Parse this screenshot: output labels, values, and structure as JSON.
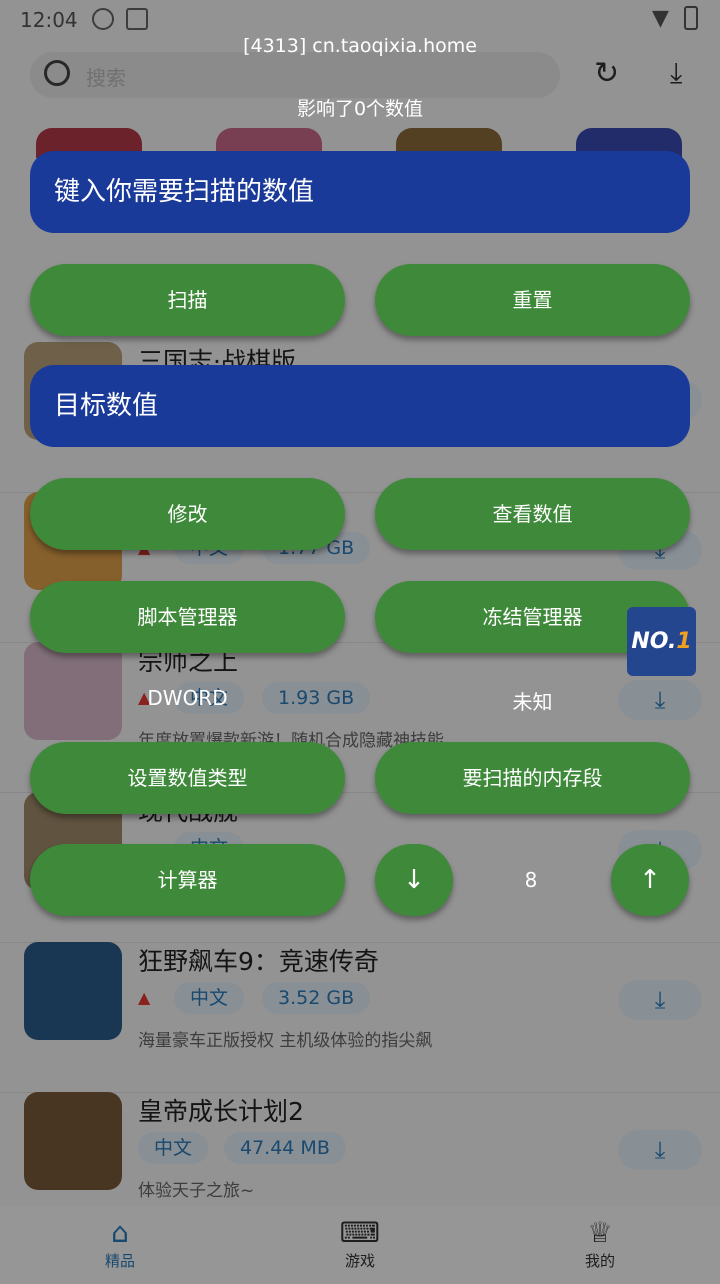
{
  "status_bar": {
    "time": "12:04"
  },
  "app": {
    "search_placeholder": "搜索",
    "games": [
      {
        "name": "三国志·战棋版",
        "tags": [],
        "desc": ""
      },
      {
        "name": "",
        "tags": [
          "中文",
          "1.77 GB"
        ],
        "desc": ""
      },
      {
        "name": "宗师之上",
        "tags": [
          "中文",
          "1.93 GB"
        ],
        "desc": "年度放置爆款新游！随机合成隐藏神技能"
      },
      {
        "name": "现代战舰",
        "tags": [
          "中文",
          ""
        ],
        "desc": ""
      },
      {
        "name": "狂野飙车9：竞速传奇",
        "tags": [
          "中文",
          "3.52 GB"
        ],
        "desc": "海量豪车正版授权 主机级体验的指尖飙"
      },
      {
        "name": "皇帝成长计划2",
        "tags": [
          "中文",
          "47.44 MB"
        ],
        "desc": "体验天子之旅~"
      }
    ],
    "tabs": [
      {
        "label": "精品",
        "icon": "home-icon",
        "active": true
      },
      {
        "label": "游戏",
        "icon": "gamepad-icon",
        "active": false
      },
      {
        "label": "我的",
        "icon": "trophy-icon",
        "active": false
      }
    ]
  },
  "tool": {
    "process_title": "[4313] cn.taoqixia.home",
    "affected_text": "影响了0个数值",
    "scan_input_placeholder": "键入你需要扫描的数值",
    "target_input_placeholder": "目标数值",
    "buttons": {
      "scan": "扫描",
      "reset": "重置",
      "modify": "修改",
      "view_values": "查看数值",
      "script_manager": "脚本管理器",
      "freeze_manager": "冻结管理器",
      "set_value_type": "设置数值类型",
      "memory_region": "要扫描的内存段",
      "calculator": "计算器",
      "down": "↓",
      "up": "↑"
    },
    "value_type": "DWORD",
    "memory_region_value": "未知",
    "step_value": "8",
    "badge_text": "NO.",
    "badge_num": "1"
  },
  "colors": {
    "accent_blue": "#1a3a9a",
    "button_green": "#3f8a3a",
    "tag_blue": "#2a7ab8"
  }
}
